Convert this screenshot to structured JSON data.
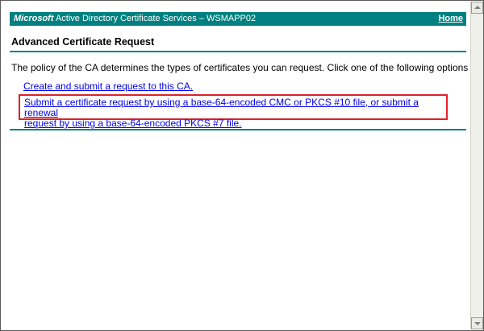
{
  "header": {
    "brand_ms": "Microsoft",
    "brand_rest": " Active Directory Certificate Services  –  WSMAPP02",
    "home_label": "Home"
  },
  "page": {
    "title": "Advanced Certificate Request",
    "intro": "The policy of the CA determines the types of certificates you can request. Click one of the following options to:"
  },
  "options": [
    {
      "label": "Create and submit a request to this CA."
    },
    {
      "label_line1": "Submit a certificate request by using a base-64-encoded CMC or PKCS #10 file, or submit a renewal",
      "label_line2": "request by using a base-64-encoded PKCS #7 file.",
      "highlighted": true
    }
  ],
  "colors": {
    "teal": "#008080",
    "link": "#0000ee",
    "highlight_border": "#e0202a"
  },
  "icons": {
    "scroll_up": "up-arrow-icon",
    "scroll_down": "down-arrow-icon"
  }
}
